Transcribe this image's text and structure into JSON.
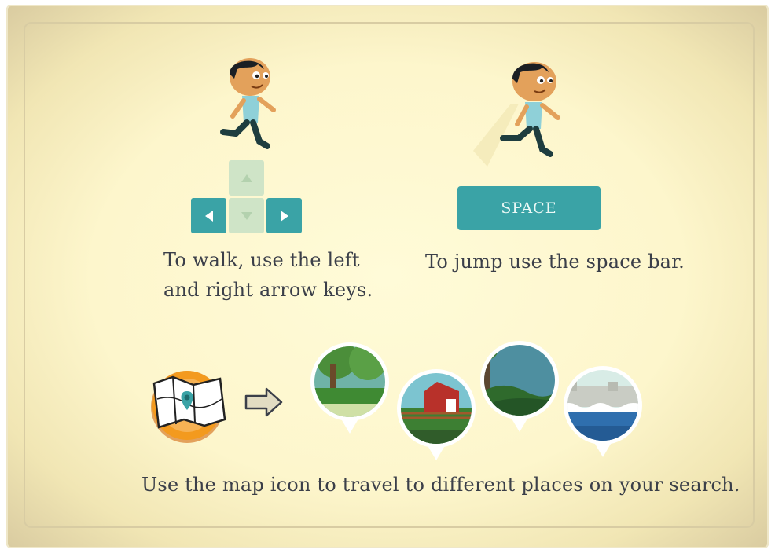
{
  "walk": {
    "caption_line1": "To walk, use the left",
    "caption_line2": "and right arrow keys.",
    "keys": {
      "up": "arrow-up",
      "left": "arrow-left",
      "down": "arrow-down",
      "right": "arrow-right"
    }
  },
  "jump": {
    "space_label": "SPACE",
    "caption": "To jump use the space bar."
  },
  "travel": {
    "caption": "Use the map icon to travel to different places on your search.",
    "places": [
      "forest",
      "farm",
      "jungle",
      "harbor"
    ]
  },
  "colors": {
    "key_teal": "#3aa3a6",
    "key_disabled": "#cfe4c7",
    "paper": "#fdf6cc",
    "text": "#3b3f49",
    "map_orange": "#f39a1e"
  }
}
